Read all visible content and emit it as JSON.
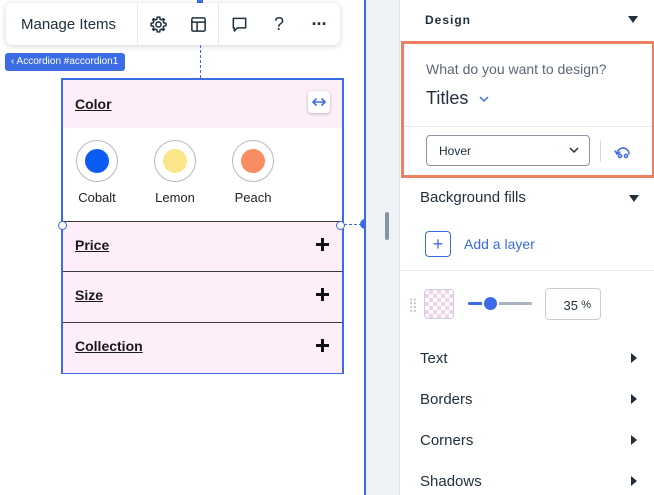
{
  "toolbar": {
    "manage_label": "Manage Items",
    "icons": [
      "gear-icon",
      "layout-icon",
      "comment-icon",
      "help-icon",
      "more-icon"
    ],
    "help_glyph": "?",
    "more_glyph": "···"
  },
  "selection_tag": "‹ Accordion #accordion1",
  "accordion": {
    "open_item": "Color",
    "swatches": [
      {
        "label": "Cobalt",
        "color": "#0a5cf5"
      },
      {
        "label": "Lemon",
        "color": "#fbe789"
      },
      {
        "label": "Peach",
        "color": "#f98c63"
      }
    ],
    "items": [
      "Price",
      "Size",
      "Collection"
    ]
  },
  "panel": {
    "title": "Design",
    "design_question": "What do you want to design?",
    "design_target": "Titles",
    "state": "Hover",
    "background_fills": "Background fills",
    "add_layer": "Add a layer",
    "opacity_value": "35",
    "opacity_unit": "%",
    "opacity_level": 0.35,
    "sections": [
      "Text",
      "Borders",
      "Corners",
      "Shadows"
    ]
  },
  "colors": {
    "selection_blue": "#3b6ce6",
    "highlight_border": "#ef7f63",
    "accordion_bg": "#fdeefa"
  }
}
